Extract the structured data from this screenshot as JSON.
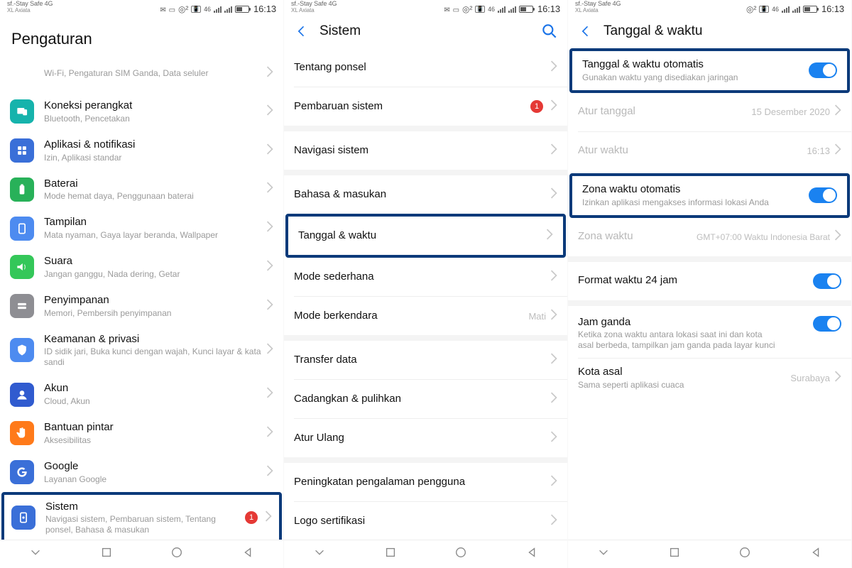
{
  "status": {
    "carrier_line1": "sf.-Stay Safe 4G",
    "carrier_line2": "XL Axiata",
    "signal_label": "46",
    "time": "16:13"
  },
  "screen1": {
    "title": "Pengaturan",
    "rows": [
      {
        "icon": "wifi",
        "title": "",
        "subtitle": "Wi-Fi, Pengaturan SIM Ganda, Data seluler"
      },
      {
        "icon": "devices",
        "title": "Koneksi perangkat",
        "subtitle": "Bluetooth, Pencetakan"
      },
      {
        "icon": "apps",
        "title": "Aplikasi & notifikasi",
        "subtitle": "Izin, Aplikasi standar"
      },
      {
        "icon": "battery",
        "title": "Baterai",
        "subtitle": "Mode hemat daya, Penggunaan baterai"
      },
      {
        "icon": "display",
        "title": "Tampilan",
        "subtitle": "Mata nyaman, Gaya layar beranda, Wallpaper"
      },
      {
        "icon": "sound",
        "title": "Suara",
        "subtitle": "Jangan ganggu, Nada dering, Getar"
      },
      {
        "icon": "storage",
        "title": "Penyimpanan",
        "subtitle": "Memori, Pembersih penyimpanan"
      },
      {
        "icon": "security",
        "title": "Keamanan & privasi",
        "subtitle": "ID sidik jari, Buka kunci dengan wajah, Kunci layar & kata sandi"
      },
      {
        "icon": "account",
        "title": "Akun",
        "subtitle": "Cloud, Akun"
      },
      {
        "icon": "assist",
        "title": "Bantuan pintar",
        "subtitle": "Aksesibilitas"
      },
      {
        "icon": "google",
        "title": "Google",
        "subtitle": "Layanan Google"
      },
      {
        "icon": "system",
        "title": "Sistem",
        "subtitle": "Navigasi sistem, Pembaruan sistem, Tentang ponsel, Bahasa & masukan",
        "badge": "1"
      }
    ]
  },
  "screen2": {
    "title": "Sistem",
    "rows": [
      {
        "title": "Tentang ponsel"
      },
      {
        "title": "Pembaruan sistem",
        "badge": "1"
      },
      {
        "title": "Navigasi sistem"
      },
      {
        "title": "Bahasa & masukan"
      },
      {
        "title": "Tanggal & waktu",
        "highlight": true
      },
      {
        "title": "Mode sederhana"
      },
      {
        "title": "Mode berkendara",
        "value": "Mati"
      },
      {
        "title": "Transfer data"
      },
      {
        "title": "Cadangkan & pulihkan"
      },
      {
        "title": "Atur Ulang"
      },
      {
        "title": "Peningkatan pengalaman pengguna"
      },
      {
        "title": "Logo sertifikasi"
      }
    ]
  },
  "screen3": {
    "title": "Tanggal & waktu",
    "rows": [
      {
        "title": "Tanggal & waktu otomatis",
        "subtitle": "Gunakan waktu yang disediakan jaringan",
        "toggle": true,
        "highlight": true
      },
      {
        "title": "Atur tanggal",
        "value": "15 Desember 2020",
        "disabled": true
      },
      {
        "title": "Atur waktu",
        "value": "16:13",
        "disabled": true
      },
      {
        "title": "Zona waktu otomatis",
        "subtitle": "Izinkan aplikasi mengakses informasi lokasi Anda",
        "toggle": true,
        "highlight": true
      },
      {
        "title": "Zona waktu",
        "value": "GMT+07:00 Waktu Indonesia Barat",
        "disabled": true
      },
      {
        "title": "Format waktu 24 jam",
        "toggle": true
      },
      {
        "title": "Jam ganda",
        "subtitle": "Ketika zona waktu antara lokasi saat ini dan kota asal berbeda, tampilkan jam ganda pada layar kunci",
        "toggle": true
      },
      {
        "title": "Kota asal",
        "subtitle": "Sama seperti aplikasi cuaca",
        "value": "Surabaya"
      }
    ]
  }
}
